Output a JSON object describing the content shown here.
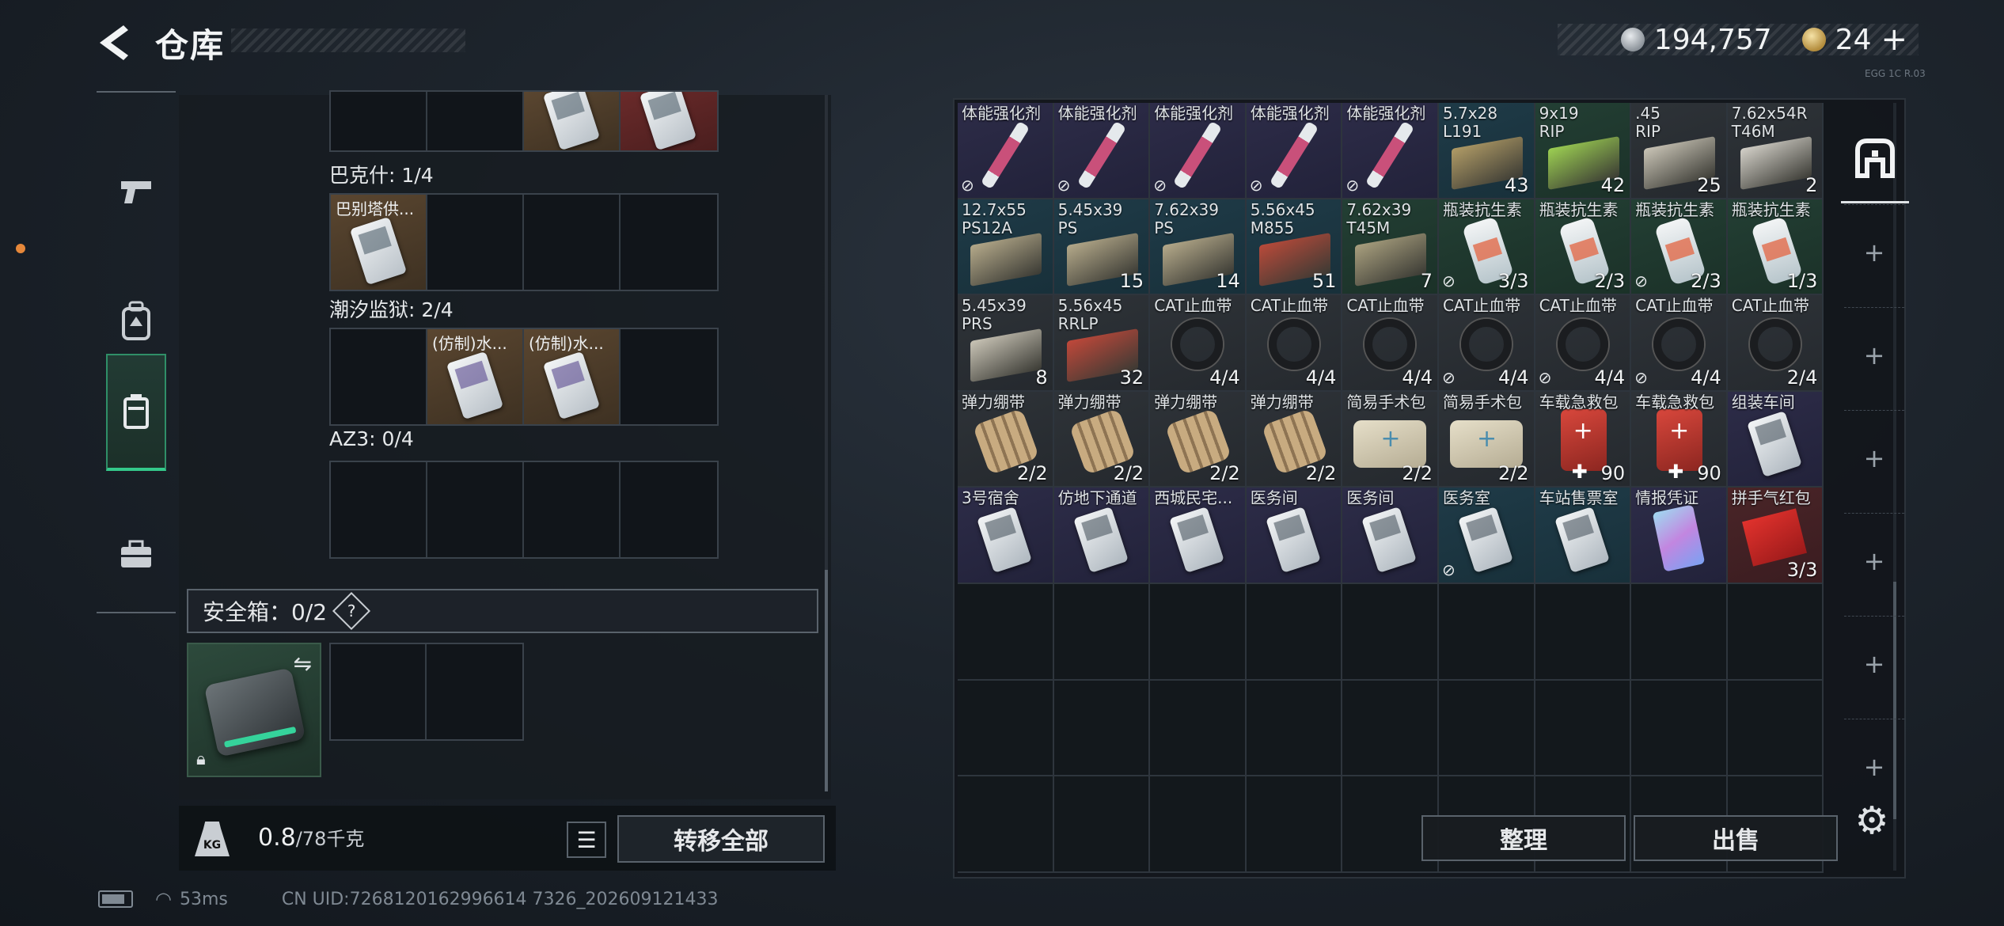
{
  "header": {
    "title": "仓库",
    "silver": "194,757",
    "gold": "24",
    "gold_plus": "+",
    "tiny_meta": "EGG 1C R.03"
  },
  "nav": {
    "items": [
      {
        "icon": "pistol-icon"
      },
      {
        "icon": "backpack-icon"
      },
      {
        "icon": "keycard-case-icon",
        "active": true
      },
      {
        "icon": "toolbox-icon"
      }
    ]
  },
  "containers": [
    {
      "label": "巴克什: 1/4",
      "slots": [
        "巴别塔供..."
      ]
    },
    {
      "label": "潮汐监狱: 2/4",
      "slots": [
        "(仿制)水...",
        "(仿制)水..."
      ]
    },
    {
      "label": "AZ3: 0/4"
    }
  ],
  "safe": {
    "label": "安全箱：0/2",
    "help": "?"
  },
  "weight": {
    "current": "0.8",
    "max": "/78千克",
    "kg": "KG"
  },
  "buttons": {
    "transfer_all": "转移全部",
    "sort": "整理",
    "sell": "出售"
  },
  "status": {
    "ping": "53ms",
    "uid": "CN UID:7268120162996614 7326_202609121433"
  },
  "warehouse": {
    "rows": [
      [
        {
          "name": "体能强化剂",
          "art": "syringe",
          "bg": "c-purple",
          "no_sell": true
        },
        {
          "name": "体能强化剂",
          "art": "syringe",
          "bg": "c-purple",
          "no_sell": true
        },
        {
          "name": "体能强化剂",
          "art": "syringe",
          "bg": "c-purple",
          "no_sell": true
        },
        {
          "name": "体能强化剂",
          "art": "syringe",
          "bg": "c-purple",
          "no_sell": true
        },
        {
          "name": "体能强化剂",
          "art": "syringe",
          "bg": "c-purple",
          "no_sell": true
        },
        {
          "name": "5.7x28\nL191",
          "art": "ammo",
          "ammo_color": "#b09b66",
          "bg": "c-teal",
          "count": "43"
        },
        {
          "name": "9x19\nRIP",
          "art": "ammo",
          "ammo_color": "#9ccf52",
          "bg": "c-green",
          "count": "42"
        },
        {
          "name": ".45\nRIP",
          "art": "ammo",
          "ammo_color": "#c9c4b6",
          "bg": "c-gray",
          "count": "25"
        },
        {
          "name": "7.62x54R\nT46M",
          "art": "ammo",
          "ammo_color": "#d3d0c8",
          "bg": "c-gray",
          "count": "2"
        }
      ],
      [
        {
          "name": "12.7x55\nPS12A",
          "art": "ammo",
          "ammo_color": "#b4a98a",
          "bg": "c-teal"
        },
        {
          "name": "5.45x39\nPS",
          "art": "ammo",
          "ammo_color": "#b4a98a",
          "bg": "c-teal",
          "count": "15"
        },
        {
          "name": "7.62x39\nPS",
          "art": "ammo",
          "ammo_color": "#b4a98a",
          "bg": "c-teal",
          "count": "14"
        },
        {
          "name": "5.56x45\nM855",
          "art": "ammo",
          "ammo_color": "#b84a3a",
          "bg": "c-teal",
          "count": "51"
        },
        {
          "name": "7.62x39\nT45M",
          "art": "ammo",
          "ammo_color": "#a89f7e",
          "bg": "c-green",
          "count": "7"
        },
        {
          "name": "瓶装抗生素",
          "art": "bottle",
          "bg": "c-green",
          "count": "3/3",
          "no_sell": true
        },
        {
          "name": "瓶装抗生素",
          "art": "bottle",
          "bg": "c-green",
          "count": "2/3"
        },
        {
          "name": "瓶装抗生素",
          "art": "bottle",
          "bg": "c-green",
          "count": "2/3",
          "no_sell": true
        },
        {
          "name": "瓶装抗生素",
          "art": "bottle",
          "bg": "c-green",
          "count": "1/3"
        }
      ],
      [
        {
          "name": "5.45x39\nPRS",
          "art": "ammo",
          "ammo_color": "#c9c4b6",
          "bg": "c-gray",
          "count": "8"
        },
        {
          "name": "5.56x45\nRRLP",
          "art": "ammo",
          "ammo_color": "#c0483a",
          "bg": "c-gray",
          "count": "32"
        },
        {
          "name": "CAT止血带",
          "art": "tourniquet",
          "bg": "c-gray",
          "count": "4/4"
        },
        {
          "name": "CAT止血带",
          "art": "tourniquet",
          "bg": "c-gray",
          "count": "4/4"
        },
        {
          "name": "CAT止血带",
          "art": "tourniquet",
          "bg": "c-gray",
          "count": "4/4"
        },
        {
          "name": "CAT止血带",
          "art": "tourniquet",
          "bg": "c-gray",
          "count": "4/4",
          "no_sell": true
        },
        {
          "name": "CAT止血带",
          "art": "tourniquet",
          "bg": "c-gray",
          "count": "4/4",
          "no_sell": true
        },
        {
          "name": "CAT止血带",
          "art": "tourniquet",
          "bg": "c-gray",
          "count": "4/4",
          "no_sell": true
        },
        {
          "name": "CAT止血带",
          "art": "tourniquet",
          "bg": "c-gray",
          "count": "2/4"
        }
      ],
      [
        {
          "name": "弹力绷带",
          "art": "bandage",
          "bg": "c-gray",
          "count": "2/2"
        },
        {
          "name": "弹力绷带",
          "art": "bandage",
          "bg": "c-gray",
          "count": "2/2"
        },
        {
          "name": "弹力绷带",
          "art": "bandage",
          "bg": "c-gray",
          "count": "2/2"
        },
        {
          "name": "弹力绷带",
          "art": "bandage",
          "bg": "c-gray",
          "count": "2/2"
        },
        {
          "name": "简易手术包",
          "art": "surgkit",
          "bg": "c-gray",
          "count": "2/2"
        },
        {
          "name": "简易手术包",
          "art": "surgkit",
          "bg": "c-gray",
          "count": "2/2"
        },
        {
          "name": "车载急救包",
          "art": "carkit",
          "bg": "c-gray",
          "count": "90",
          "plus": true
        },
        {
          "name": "车载急救包",
          "art": "carkit",
          "bg": "c-gray",
          "count": "90",
          "plus": true
        },
        {
          "name": "组装车间",
          "art": "card",
          "bg": "c-purple"
        }
      ],
      [
        {
          "name": "3号宿舍",
          "art": "card",
          "bg": "c-purple"
        },
        {
          "name": "仿地下通道",
          "art": "card",
          "bg": "c-purple"
        },
        {
          "name": "西城民宅...",
          "art": "card",
          "bg": "c-purple"
        },
        {
          "name": "医务间",
          "art": "card",
          "bg": "c-purple"
        },
        {
          "name": "医务间",
          "art": "card",
          "bg": "c-purple"
        },
        {
          "name": "医务室",
          "art": "card",
          "bg": "c-teal",
          "no_sell": true
        },
        {
          "name": "车站售票室",
          "art": "card",
          "bg": "c-teal"
        },
        {
          "name": "情报凭证",
          "art": "intel",
          "bg": "c-purple"
        },
        {
          "name": "拼手气红包",
          "art": "redenv",
          "bg": "c-red",
          "count": "3/3"
        }
      ]
    ],
    "empty_rows": 3
  },
  "right_tabs": {
    "add_count": 6
  },
  "colors": {
    "accent_green": "#34c98b",
    "nav_dot": "#e6883a"
  }
}
